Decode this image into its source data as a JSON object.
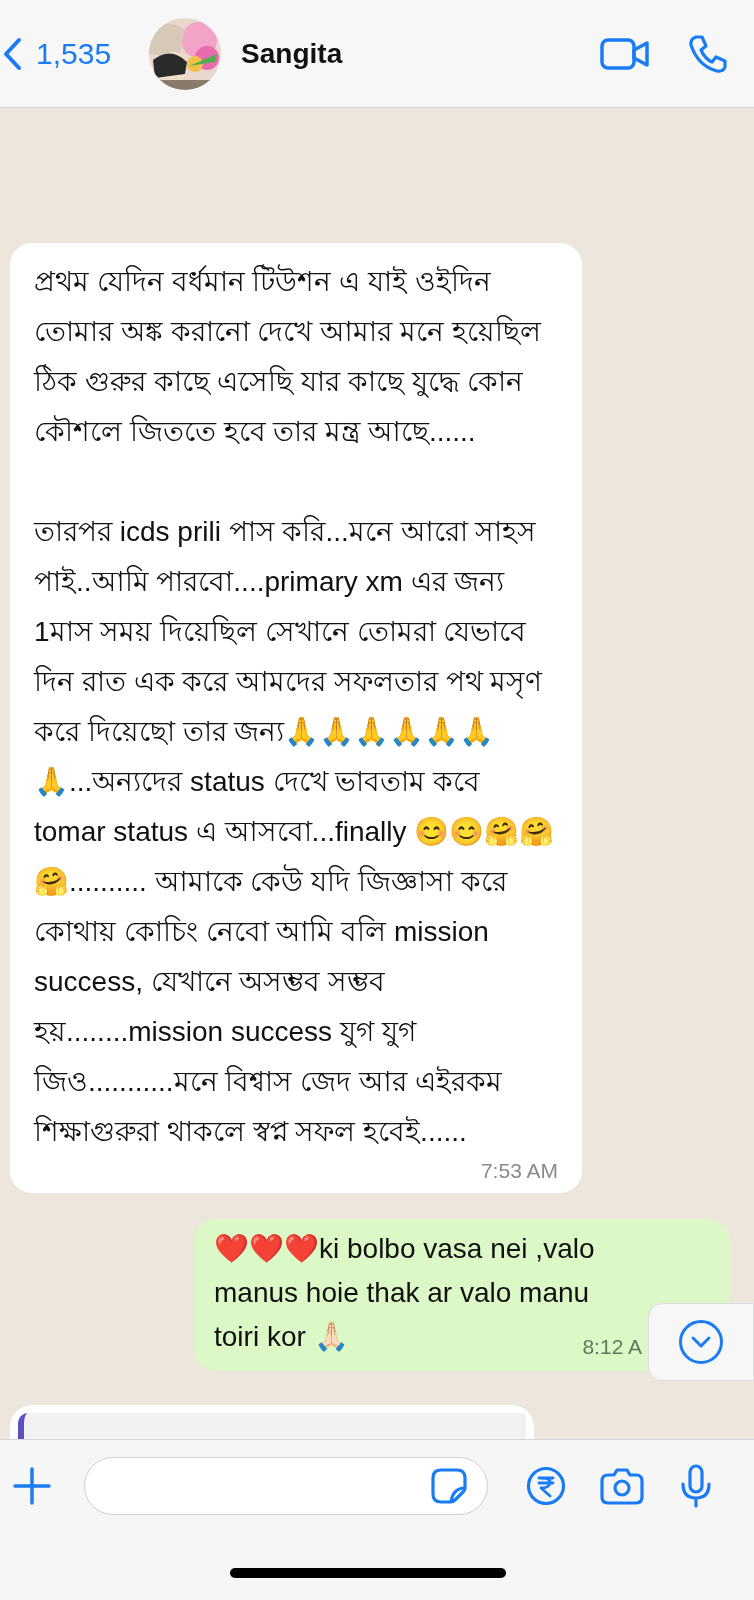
{
  "header": {
    "back_count": "1,535",
    "contact_name": "Sangita"
  },
  "messages": [
    {
      "kind": "received",
      "text": "প্রথম যেদিন বর্ধমান টিউশন এ যাই ওইদিন তোমার অঙ্ক করানো দেখে আমার মনে হয়েছিল ঠিক গুরুর কাছে এসেছি যার কাছে যুদ্ধে কোন কৌশলে জিততে হবে তার মন্ত্র আছে......\n\nতারপর icds prili পাস করি...মনে আরো সাহস পাই..আমি পারবো....primary xm এর জন্য 1মাস সময় দিয়েছিল সেখানে তোমরা যেভাবে দিন রাত এক করে আমদের সফলতার পথ মসৃণ করে দিয়েছো তার জন্য🙏🙏🙏🙏🙏🙏🙏...অন্যদের status দেখে ভাবতাম কবে tomar status এ আসবো...finally 😊😊🤗🤗🤗.......... আমাকে কেউ যদি জিজ্ঞাসা করে কোথায় কোচিং নেবো আমি বলি mission success, যেখানে অসম্ভব সম্ভব হয়........mission success যুগ যুগ জিও...........মনে বিশ্বাস জেদ আর এইরকম শিক্ষাগুরুরা থাকলে স্বপ্ন সফল হবেই......",
      "time": "7:53 AM"
    },
    {
      "kind": "sent",
      "lines": [
        "❤️❤️❤️ki bolbo vasa nei ,valo",
        "manus hoie thak ar valo manu",
        "toiri kor 🙏🏻"
      ],
      "time": "8:12 A"
    },
    {
      "kind": "cut_off"
    }
  ]
}
